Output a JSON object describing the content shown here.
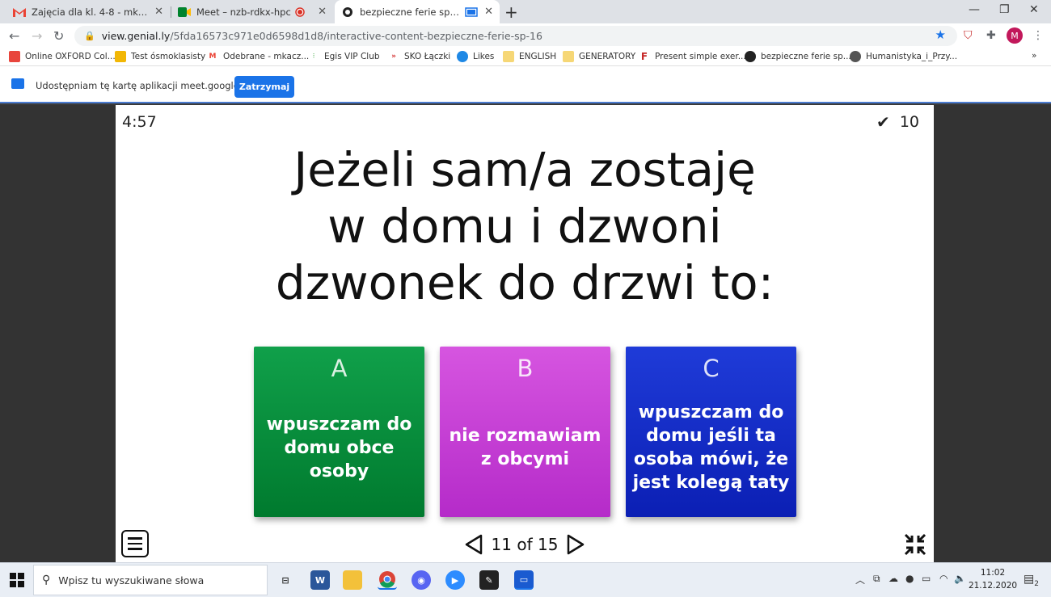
{
  "browser": {
    "tabs": [
      {
        "title": "Zajęcia dla kl. 4-8 - mkaczmarczyk",
        "icon": "gmail-icon",
        "active": false
      },
      {
        "title": "Meet – nzb-rdkx-hpc",
        "icon": "meet-icon",
        "active": false
      },
      {
        "title": "bezpieczne ferie sp 16 by Ma",
        "icon": "genially-icon",
        "active": true
      }
    ],
    "url_host": "view.genial.ly",
    "url_path": "/5fda16573c971e0d6598d1d8/interactive-content-bezpieczne-ferie-sp-16",
    "profile_initial": "M",
    "bookmarks": [
      {
        "label": "Online OXFORD Col...",
        "color": "#e8453c"
      },
      {
        "label": "Test ósmoklasisty",
        "color": "#f2b705"
      },
      {
        "label": "Odebrane - mkacz...",
        "color": "#ea4335"
      },
      {
        "label": "Egis VIP Club",
        "color": "#4caf50"
      },
      {
        "label": "SKO Łączki",
        "color": "#d32f2f"
      },
      {
        "label": "Likes",
        "color": "#1e88e5"
      },
      {
        "label": "ENGLISH",
        "color": "#f6d776"
      },
      {
        "label": "GENERATORY",
        "color": "#f6d776"
      },
      {
        "label": "Present simple exer...",
        "color": "#c62828"
      },
      {
        "label": "bezpieczne ferie sp...",
        "color": "#222222"
      },
      {
        "label": "Humanistyka_i_Przy...",
        "color": "#555555"
      }
    ],
    "more_bookmarks": "»"
  },
  "share_bar": {
    "text": "Udostępniam tę kartę aplikacji meet.google.com",
    "stop_button": "Zatrzymaj"
  },
  "slide": {
    "timer": "4:57",
    "score": "10",
    "question_lines": [
      "Jeżeli sam/a zostaję",
      "w domu i dzwoni",
      "dzwonek do drzwi to:"
    ],
    "answers": [
      {
        "letter": "A",
        "text": "wpuszczam do domu obce osoby",
        "color": "#0a8f3c"
      },
      {
        "letter": "B",
        "text": "nie rozmawiam z obcymi",
        "color": "#c93fd6"
      },
      {
        "letter": "C",
        "text": "wpuszczam do domu jeśli ta osoba mówi, że jest kolegą taty",
        "color": "#1428c8"
      }
    ],
    "pager": "11 of 15"
  },
  "taskbar": {
    "search_placeholder": "Wpisz tu wyszukiwane słowa",
    "time": "11:02",
    "date": "21.12.2020",
    "notifications": "2"
  }
}
